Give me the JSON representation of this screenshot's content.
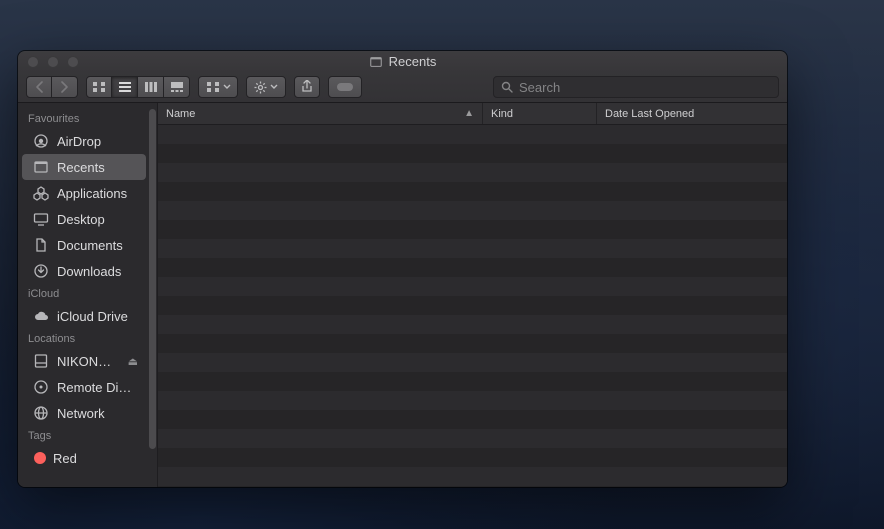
{
  "window": {
    "title": "Recents"
  },
  "search": {
    "placeholder": "Search"
  },
  "sidebar": {
    "sections": [
      {
        "label": "Favourites",
        "items": [
          {
            "icon": "airdrop-icon",
            "label": "AirDrop"
          },
          {
            "icon": "recents-icon",
            "label": "Recents",
            "selected": true
          },
          {
            "icon": "apps-icon",
            "label": "Applications"
          },
          {
            "icon": "desktop-icon",
            "label": "Desktop"
          },
          {
            "icon": "documents-icon",
            "label": "Documents"
          },
          {
            "icon": "downloads-icon",
            "label": "Downloads"
          }
        ]
      },
      {
        "label": "iCloud",
        "items": [
          {
            "icon": "cloud-icon",
            "label": "iCloud Drive"
          }
        ]
      },
      {
        "label": "Locations",
        "items": [
          {
            "icon": "disk-icon",
            "label": "NIKON…",
            "ejectable": true
          },
          {
            "icon": "remote-disc-icon",
            "label": "Remote Di…"
          },
          {
            "icon": "network-icon",
            "label": "Network"
          }
        ]
      },
      {
        "label": "Tags",
        "items": [
          {
            "icon": "tag-red",
            "label": "Red"
          }
        ]
      }
    ]
  },
  "columns": {
    "name": "Name",
    "kind": "Kind",
    "date": "Date Last Opened"
  },
  "rows": [],
  "colors": {
    "tagRed": "#fc605c"
  }
}
